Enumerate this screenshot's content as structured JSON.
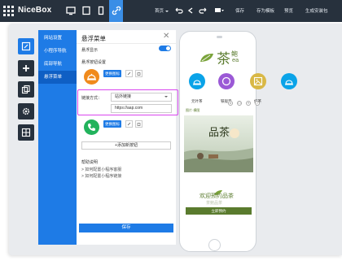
{
  "app": {
    "brand": "NiceBox"
  },
  "topbar": {
    "nav_label": "首页",
    "preview_label": "",
    "save_label": "保存",
    "save_template_label": "存为模板",
    "preview_btn_label": "预览",
    "generate_label": "生成安装包"
  },
  "sidebar": {
    "items": [
      {
        "label": "网站设置"
      },
      {
        "label": "小程序导航"
      },
      {
        "label": "底部导航"
      },
      {
        "label": "悬浮菜单"
      }
    ]
  },
  "panel": {
    "title": "悬浮菜单",
    "show_label": "悬浮显示",
    "button_settings_label": "悬浮按钮设置",
    "change_icon_label": "更换图标",
    "link_type_label": "链接方式：",
    "link_type_value": "站外链接",
    "url_value": "https://aap.com",
    "add_button_label": "+添加新按钮",
    "help_title": "帮助说明",
    "help_items": [
      "> 如何配置小程序客服",
      "> 如何配置小程序链接"
    ],
    "save_label": "保存"
  },
  "preview": {
    "logo_text": "茶",
    "logo_sub": "鲍",
    "logo_ea": "ea",
    "menu": [
      {
        "label": "元叶茶",
        "color": "#0aa3e8"
      },
      {
        "label": "铁观音",
        "color": "#9b59d6"
      },
      {
        "label": "红茶",
        "color": "#d9b846"
      },
      {
        "label": "绿茶",
        "color": "#0aa3e8"
      }
    ],
    "tag_label": "图片·横图",
    "banner_text": "品茶",
    "welcome_text": "欢迎预约品茶",
    "welcome_sub": "茶鲍品茶",
    "reserve_label": "立即预约"
  },
  "colors": {
    "accent": "#1e7be6",
    "topbar": "#27313d",
    "brand_green": "#5a7b2e",
    "highlight": "#d946ef"
  }
}
